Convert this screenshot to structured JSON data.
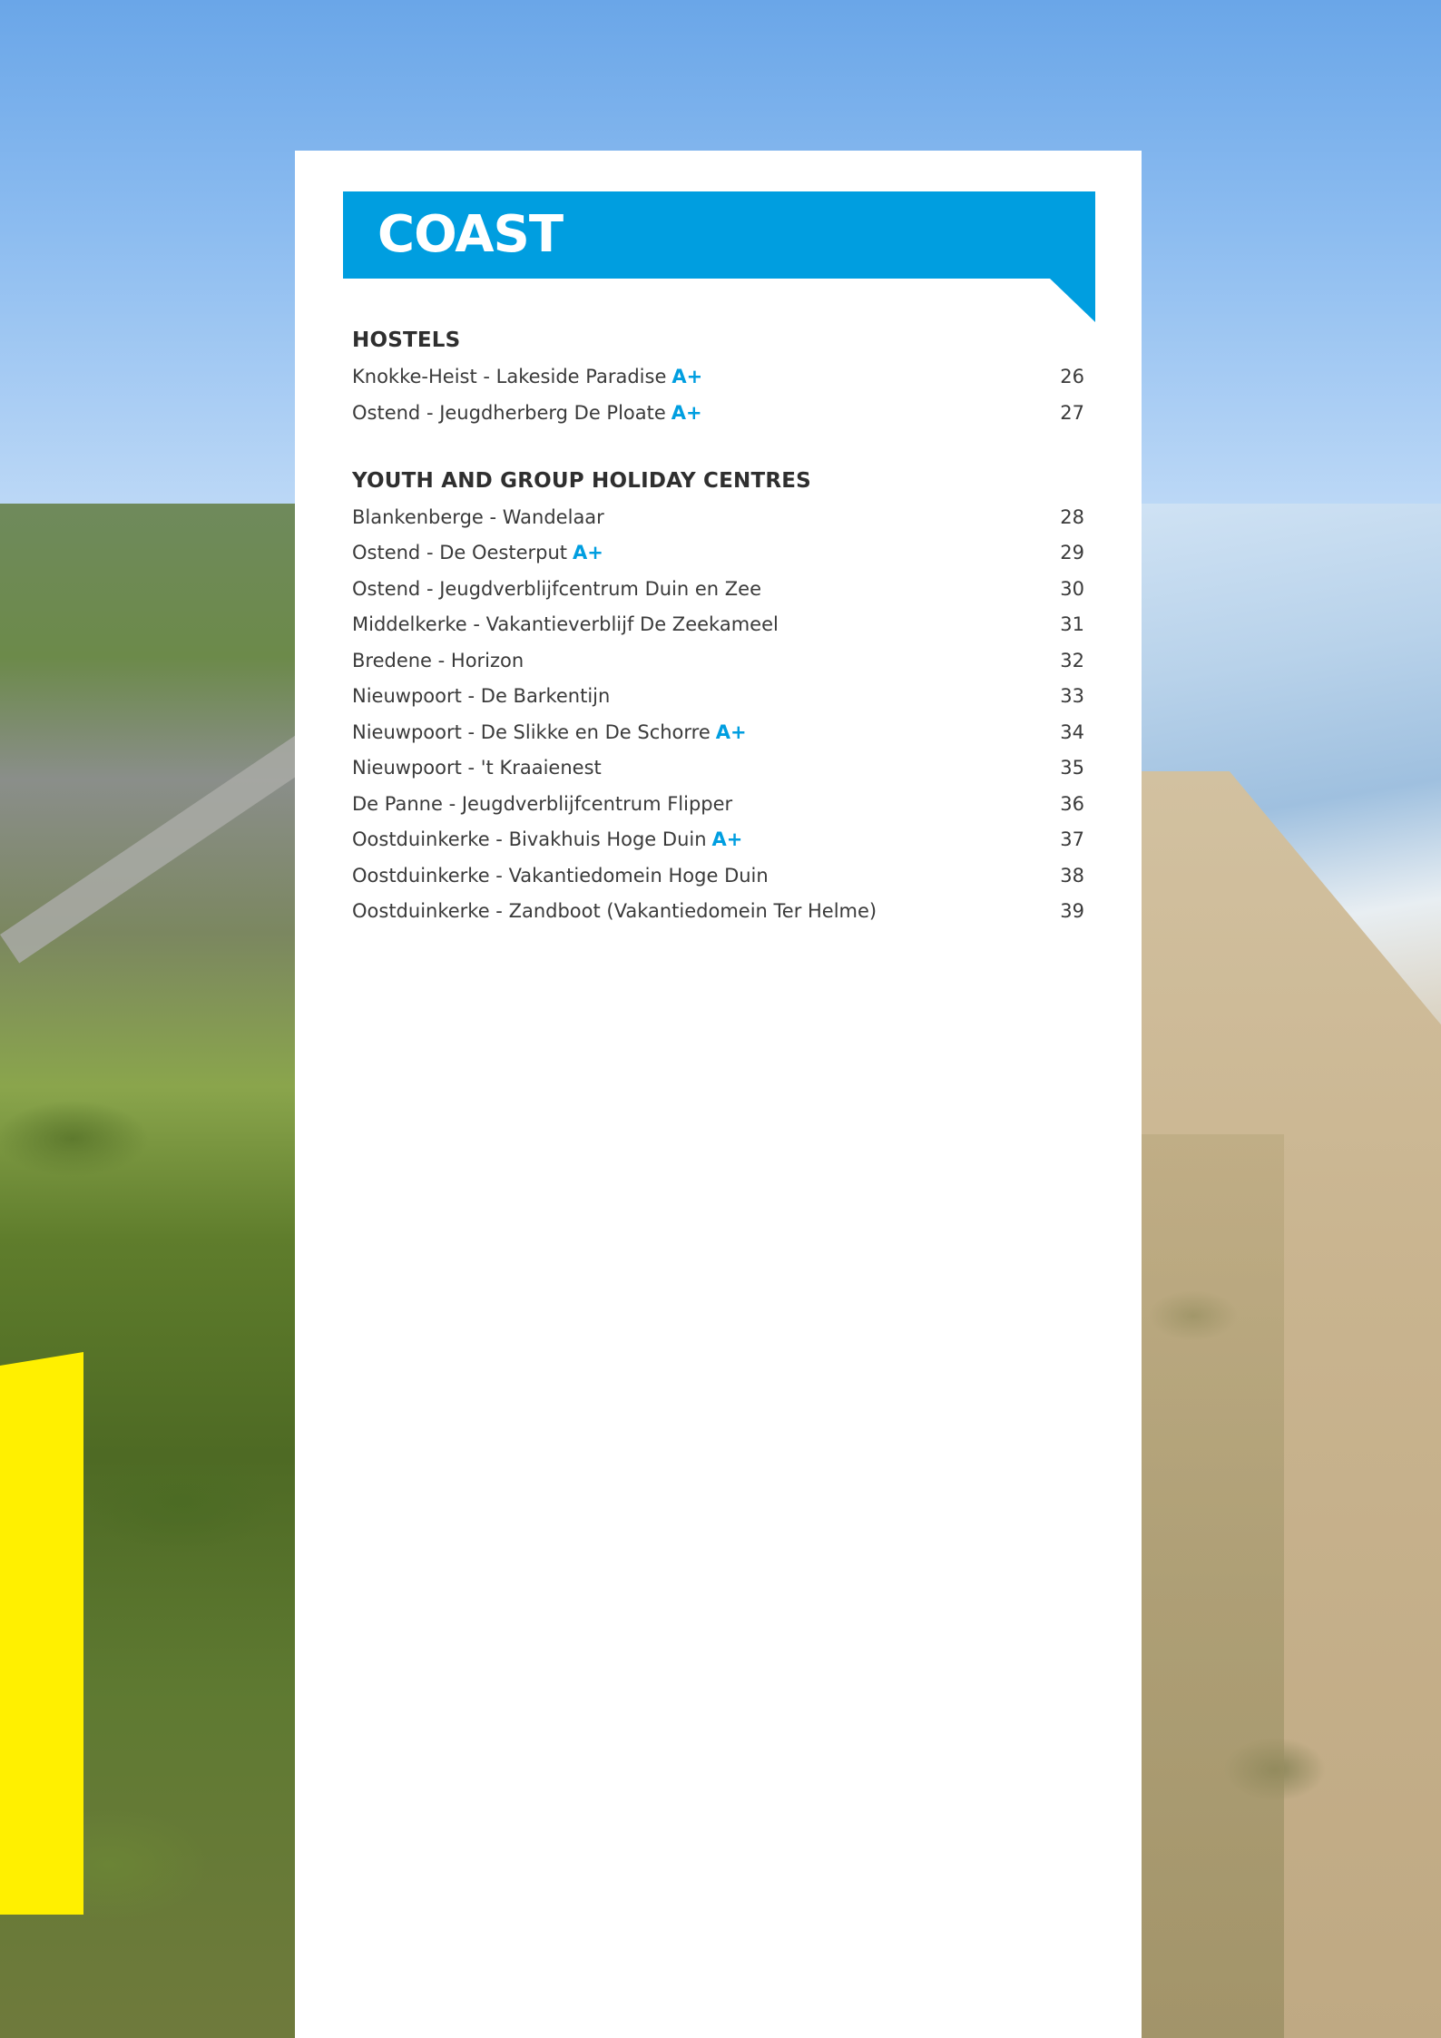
{
  "colors": {
    "accent": "#009ee0",
    "highlight": "#fff000",
    "text": "#3a3a3a"
  },
  "banner": {
    "title": "COAST"
  },
  "sections": [
    {
      "heading": "HOSTELS",
      "items": [
        {
          "label": "Knokke-Heist - Lakeside Paradise",
          "badge": "A+",
          "page": "26"
        },
        {
          "label": "Ostend - Jeugdherberg De Ploate",
          "badge": "A+",
          "page": "27"
        }
      ]
    },
    {
      "heading": "YOUTH AND GROUP HOLIDAY CENTRES",
      "items": [
        {
          "label": "Blankenberge - Wandelaar",
          "badge": "",
          "page": "28"
        },
        {
          "label": "Ostend - De Oesterput",
          "badge": "A+",
          "page": "29"
        },
        {
          "label": "Ostend - Jeugdverblijfcentrum Duin en Zee",
          "badge": "",
          "page": "30"
        },
        {
          "label": "Middelkerke - Vakantieverblijf De Zeekameel",
          "badge": "",
          "page": "31"
        },
        {
          "label": "Bredene - Horizon",
          "badge": "",
          "page": "32"
        },
        {
          "label": "Nieuwpoort - De Barkentijn",
          "badge": "",
          "page": "33"
        },
        {
          "label": "Nieuwpoort - De Slikke en De Schorre",
          "badge": "A+",
          "page": "34"
        },
        {
          "label": "Nieuwpoort - 't Kraaienest",
          "badge": "",
          "page": "35"
        },
        {
          "label": "De Panne - Jeugdverblijfcentrum Flipper",
          "badge": "",
          "page": "36"
        },
        {
          "label": "Oostduinkerke - Bivakhuis Hoge Duin",
          "badge": "A+",
          "page": "37"
        },
        {
          "label": "Oostduinkerke - Vakantiedomein Hoge Duin",
          "badge": "",
          "page": "38"
        },
        {
          "label": "Oostduinkerke - Zandboot (Vakantiedomein Ter Helme)",
          "badge": "",
          "page": "39"
        }
      ]
    }
  ]
}
